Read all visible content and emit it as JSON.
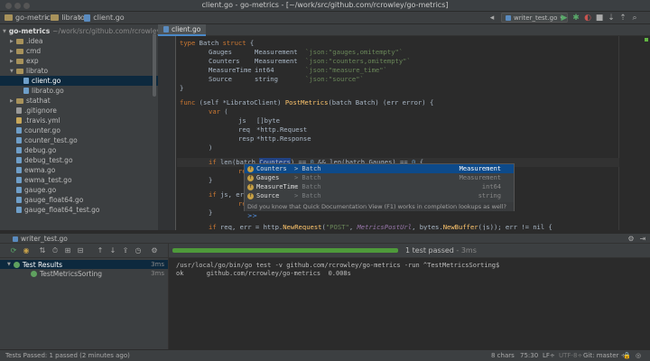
{
  "window": {
    "title": "client.go - go-metrics - [~/work/src/github.com/rcrowley/go-metrics]"
  },
  "navbar": {
    "crumbs": [
      "go-metrics",
      "librato",
      "client.go"
    ],
    "run_config": "writer_test.go"
  },
  "project": {
    "root_name": "go-metrics",
    "root_path": "~/work/src/github.com/rcrowley/go-metrics",
    "items": [
      {
        "label": ".idea"
      },
      {
        "label": "cmd"
      },
      {
        "label": "exp"
      },
      {
        "label": "librato"
      },
      {
        "label": "client.go"
      },
      {
        "label": "librato.go"
      },
      {
        "label": "stathat"
      },
      {
        "label": ".gitignore"
      },
      {
        "label": ".travis.yml"
      },
      {
        "label": "counter.go"
      },
      {
        "label": "counter_test.go"
      },
      {
        "label": "debug.go"
      },
      {
        "label": "debug_test.go"
      },
      {
        "label": "ewma.go"
      },
      {
        "label": "ewma_test.go"
      },
      {
        "label": "gauge.go"
      },
      {
        "label": "gauge_float64.go"
      },
      {
        "label": "gauge_float64_test.go"
      }
    ]
  },
  "editor": {
    "tab": "client.go",
    "code": {
      "l1_kw": "type",
      "l1_name": " Batch ",
      "l1_kw2": "struct",
      "l1_rest": " {",
      "l2_field": "Gauges",
      "l2_type": "Measurement",
      "l2_tag": "`json:\"gauges,omitempty\"`",
      "l3_field": "Counters",
      "l3_type": "Measurement",
      "l3_tag": "`json:\"counters,omitempty\"`",
      "l4_field": "MeasureTime",
      "l4_type": "int64",
      "l4_tag": "`json:\"measure_time\"`",
      "l5_field": "Source",
      "l5_type": "string",
      "l5_tag": "`json:\"source\"`",
      "l6": "}",
      "l8_kw": "func",
      "l8_recv": " (self *LibratoClient) ",
      "l8_fn": "PostMetrics",
      "l8_rest": "(batch Batch) (err error) {",
      "l9_kw": "var",
      "l9_rest": " (",
      "l10_a": "js",
      "l10_b": "[]byte",
      "l11_a": "req",
      "l11_b": "*http.Request",
      "l12_a": "resp",
      "l12_b": "*http.Response",
      "l13": ")",
      "l15_kw": "if",
      "l15_a": " len(batch.",
      "l15_sel": "Counters",
      "l15_b": ") == ",
      "l15_n1": "0",
      "l15_c": " && len(batch.Gauges) == ",
      "l15_n2": "0",
      "l15_d": " {",
      "l16": "re",
      "l17": "}",
      "l19_kw": "if",
      "l19_rest": " js, err",
      "l20": "re",
      "l21": "}",
      "l23_kw": "if",
      "l23_a": " req, err = http.",
      "l23_fn": "NewRequest",
      "l23_b": "(",
      "l23_s": "\"POST\"",
      "l23_c": ", ",
      "l23_p": "MetricsPostUrl",
      "l23_d": ", bytes.",
      "l23_fn2": "NewBuffer",
      "l23_e": "(js)); err != nil {"
    }
  },
  "completion": {
    "items": [
      {
        "name": "Counters",
        "owner": "> Batch",
        "type": "Measurement"
      },
      {
        "name": "Gauges",
        "owner": "> Batch",
        "type": "Measurement"
      },
      {
        "name": "MeasureTime",
        "owner": "> Batch",
        "type": "int64"
      },
      {
        "name": "Source",
        "owner": "> Batch",
        "type": "string"
      }
    ],
    "hint": "Did you know that Quick Documentation View (F1) works in completion lookups as well?",
    "hint_link": ">>"
  },
  "run": {
    "tab_label": "writer_test.go",
    "status": "1 test passed",
    "duration": "- 3ms",
    "progress_fraction": 1.0,
    "tree": [
      {
        "label": "Test Results",
        "time": "3ms"
      },
      {
        "label": "TestMetricsSorting",
        "time": "3ms"
      }
    ],
    "output": [
      "/usr/local/go/bin/go test -v github.com/rcrowley/go-metrics -run ^TestMetricsSorting$",
      "ok      github.com/rcrowley/go-metrics  0.008s"
    ]
  },
  "statusbar": {
    "message": "Tests Passed: 1 passed (2 minutes ago)",
    "chars": "8 chars",
    "position": "75:30",
    "line_sep": "LF÷",
    "encoding": "UTF-8÷",
    "git": "Git: master ÷"
  },
  "colors": {
    "accent": "#4a88c7",
    "selection": "#0d293e",
    "success": "#4e9a3a"
  }
}
